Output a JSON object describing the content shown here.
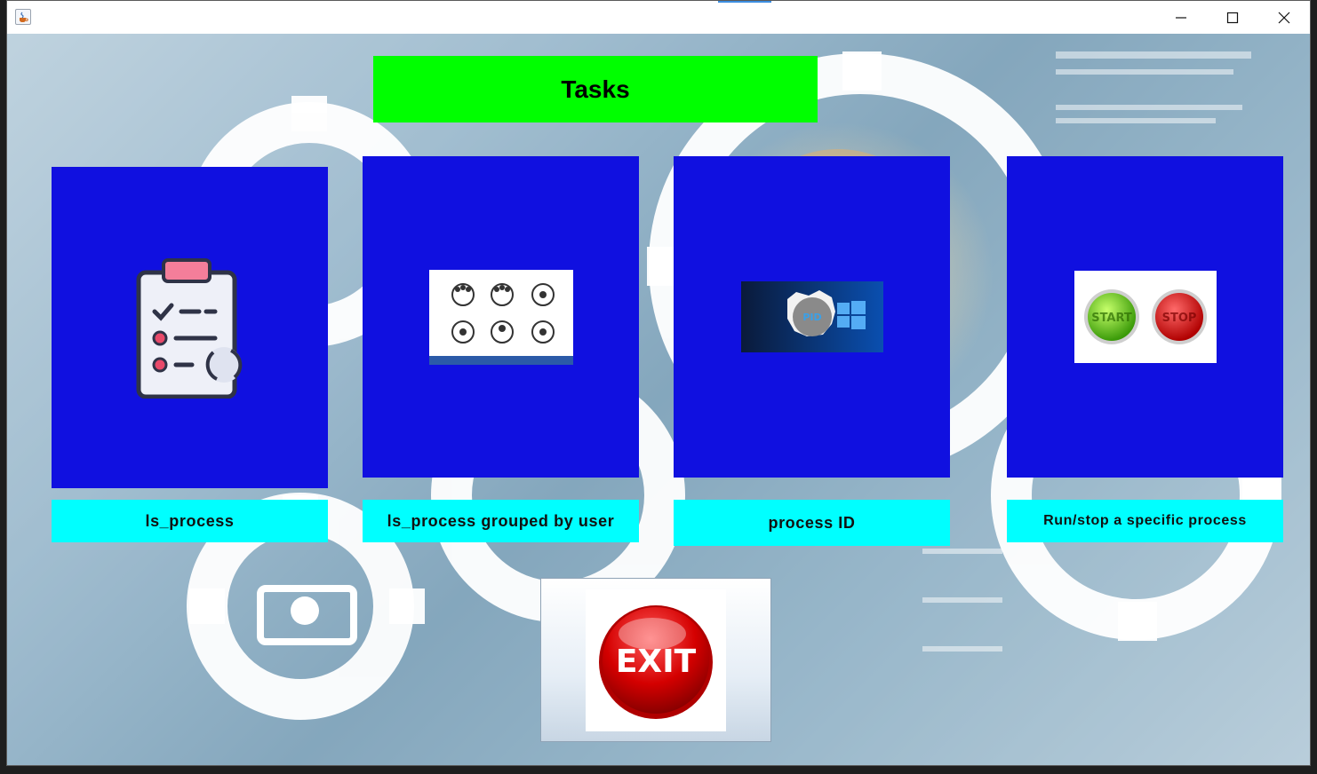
{
  "window": {
    "app_icon": "java-cup-icon",
    "controls": [
      "minimize-icon",
      "maximize-icon",
      "close-icon"
    ]
  },
  "header": {
    "title": "Tasks"
  },
  "tasks": [
    {
      "label": "ls_process",
      "icon": "clipboard-checklist-icon"
    },
    {
      "label": "ls_process grouped by user",
      "icon": "gears-team-icon"
    },
    {
      "label": "process ID",
      "icon": "pid-windows-icon"
    },
    {
      "label": "Run/stop a specific process",
      "icon": "start-stop-buttons-icon"
    }
  ],
  "exit": {
    "label": "EXIT",
    "icon": "exit-button-icon"
  },
  "pid_badge_text": "PID",
  "start_text": "START",
  "stop_text": "STOP",
  "colors": {
    "header_bg": "#00ff00",
    "tile_bg": "#1010e0",
    "label_bg": "#00ffff"
  }
}
